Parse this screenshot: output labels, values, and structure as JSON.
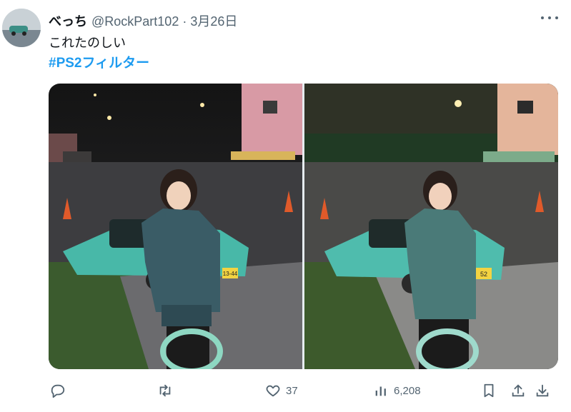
{
  "tweet": {
    "display_name": "べっち",
    "meta": "@RockPart102 · 3月26日",
    "text": "これたのしい",
    "hashtag": "#PS2フィルター"
  },
  "media": {
    "photos": [
      {
        "kind": "real-photo",
        "plate": "13-44"
      },
      {
        "kind": "ps2-filter-render",
        "plate": "52"
      }
    ]
  },
  "actions": {
    "likes": "37",
    "views": "6,208"
  },
  "colors": {
    "link": "#1d9bf0",
    "muted": "#536471",
    "text": "#0f1419"
  },
  "icons": [
    "reply-icon",
    "retweet-icon",
    "like-icon",
    "views-icon",
    "bookmark-icon",
    "share-icon",
    "download-icon",
    "more-icon"
  ]
}
